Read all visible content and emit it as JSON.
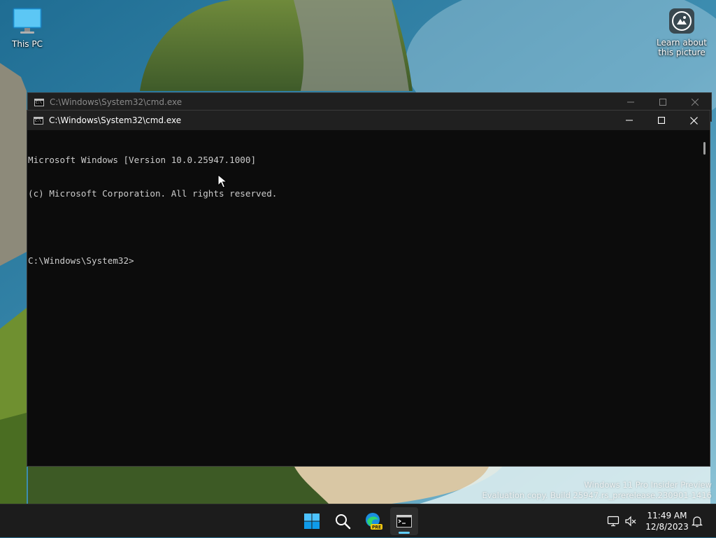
{
  "desktop": {
    "this_pc_label": "This PC",
    "learn_label_line1": "Learn about",
    "learn_label_line2": "this picture"
  },
  "watermark": {
    "line1": "Windows 11 Pro Insider Preview",
    "line2": "Evaluation copy. Build 25947.rs_prerelease.230901-1416"
  },
  "background_window": {
    "title": "C:\\Windows\\System32\\cmd.exe"
  },
  "window": {
    "title": "C:\\Windows\\System32\\cmd.exe",
    "console_lines": [
      "Microsoft Windows [Version 10.0.25947.1000]",
      "(c) Microsoft Corporation. All rights reserved.",
      "",
      "C:\\Windows\\System32>"
    ]
  },
  "taskbar": {
    "start_icon": "windows-logo-icon",
    "search_icon": "search-icon",
    "edge_badge": "PRE",
    "terminal_icon": "terminal-icon",
    "clock_time": "11:49 AM",
    "clock_date": "12/8/2023"
  },
  "colors": {
    "accent": "#60cdff",
    "console_bg": "#0c0c0c",
    "console_fg": "#cccccc",
    "taskbar_bg": "#1c1c1c"
  }
}
